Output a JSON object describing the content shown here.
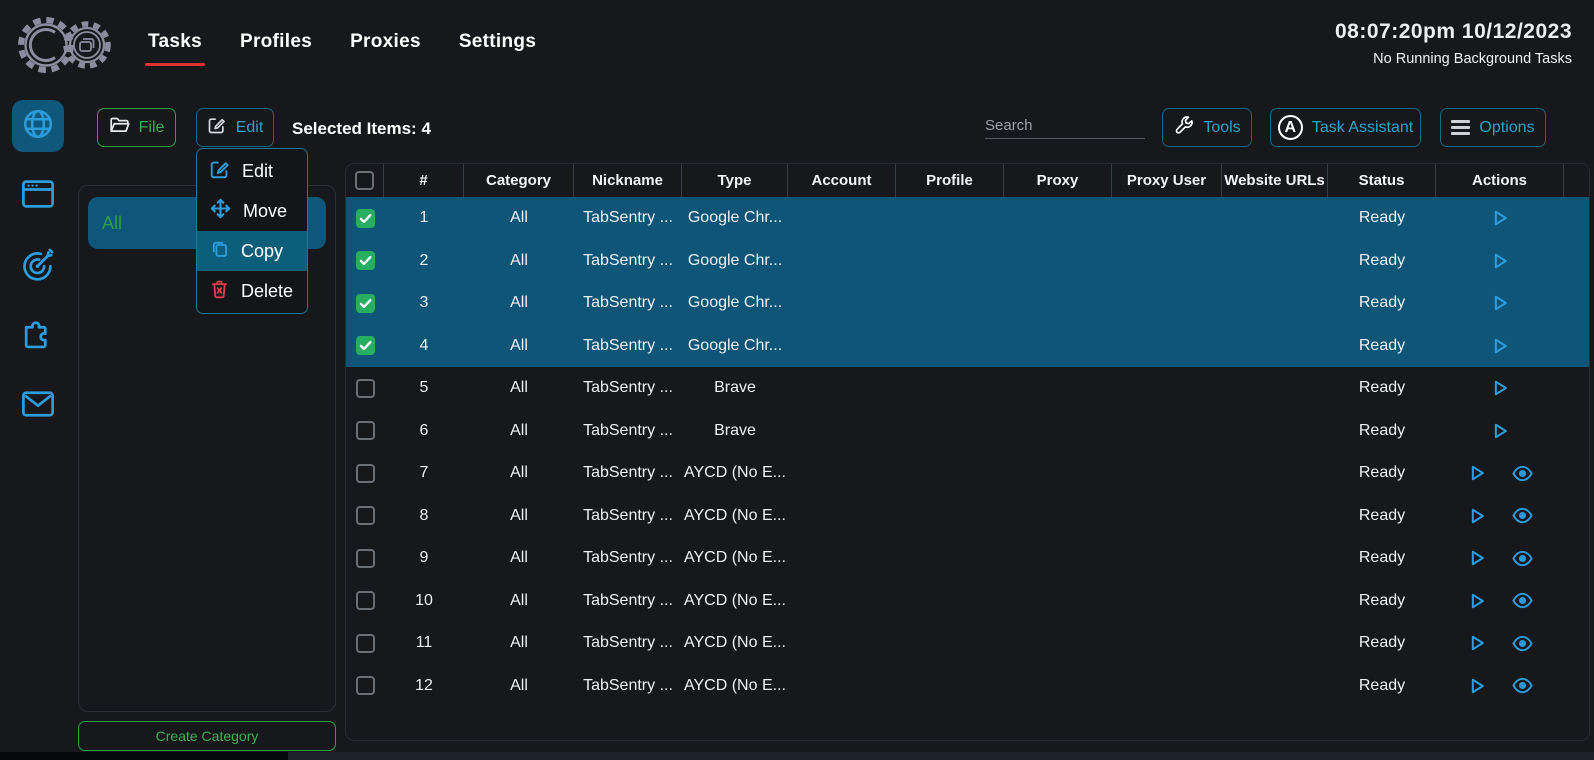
{
  "topbar": {
    "nav": [
      {
        "label": "Tasks",
        "active": true
      },
      {
        "label": "Profiles",
        "active": false
      },
      {
        "label": "Proxies",
        "active": false
      },
      {
        "label": "Settings",
        "active": false
      }
    ],
    "clock": "08:07:20pm 10/12/2023",
    "background_status": "No Running Background Tasks"
  },
  "sidebar": {
    "items": [
      {
        "icon": "globe",
        "active": true
      },
      {
        "icon": "browser-window",
        "active": false
      },
      {
        "icon": "target-dart",
        "active": false
      },
      {
        "icon": "puzzle-piece",
        "active": false
      },
      {
        "icon": "mail-envelope",
        "active": false
      }
    ]
  },
  "toolbar": {
    "file_label": "File",
    "edit_label": "Edit",
    "selected_items": "Selected Items: 4",
    "search_placeholder": "Search",
    "tools_label": "Tools",
    "task_assistant_label": "Task Assistant",
    "options_label": "Options"
  },
  "edit_menu": {
    "items": [
      {
        "label": "Edit",
        "icon": "edit-pencil",
        "highlighted": false,
        "danger": false
      },
      {
        "label": "Move",
        "icon": "move-arrows",
        "highlighted": false,
        "danger": false
      },
      {
        "label": "Copy",
        "icon": "copy-squares",
        "highlighted": true,
        "danger": false
      },
      {
        "label": "Delete",
        "icon": "trash",
        "highlighted": false,
        "danger": true
      }
    ]
  },
  "categories": {
    "selected_category": "All",
    "create_button_label": "Create Category"
  },
  "table": {
    "columns": [
      "",
      "#",
      "Category",
      "Nickname",
      "Type",
      "Account",
      "Profile",
      "Proxy",
      "Proxy User",
      "Website URLs",
      "Status",
      "Actions"
    ],
    "rows": [
      {
        "num": "1",
        "category": "All",
        "nickname": "TabSentry ...",
        "type": "Google Chr...",
        "account": "",
        "profile": "",
        "proxy": "",
        "proxy_user": "",
        "website_urls": "",
        "status": "Ready",
        "checked": true,
        "selected": true,
        "actions": [
          "play"
        ]
      },
      {
        "num": "2",
        "category": "All",
        "nickname": "TabSentry ...",
        "type": "Google Chr...",
        "account": "",
        "profile": "",
        "proxy": "",
        "proxy_user": "",
        "website_urls": "",
        "status": "Ready",
        "checked": true,
        "selected": true,
        "actions": [
          "play"
        ]
      },
      {
        "num": "3",
        "category": "All",
        "nickname": "TabSentry ...",
        "type": "Google Chr...",
        "account": "",
        "profile": "",
        "proxy": "",
        "proxy_user": "",
        "website_urls": "",
        "status": "Ready",
        "checked": true,
        "selected": true,
        "actions": [
          "play"
        ]
      },
      {
        "num": "4",
        "category": "All",
        "nickname": "TabSentry ...",
        "type": "Google Chr...",
        "account": "",
        "profile": "",
        "proxy": "",
        "proxy_user": "",
        "website_urls": "",
        "status": "Ready",
        "checked": true,
        "selected": true,
        "actions": [
          "play"
        ]
      },
      {
        "num": "5",
        "category": "All",
        "nickname": "TabSentry ...",
        "type": "Brave",
        "account": "",
        "profile": "",
        "proxy": "",
        "proxy_user": "",
        "website_urls": "",
        "status": "Ready",
        "checked": false,
        "selected": false,
        "actions": [
          "play"
        ]
      },
      {
        "num": "6",
        "category": "All",
        "nickname": "TabSentry ...",
        "type": "Brave",
        "account": "",
        "profile": "",
        "proxy": "",
        "proxy_user": "",
        "website_urls": "",
        "status": "Ready",
        "checked": false,
        "selected": false,
        "actions": [
          "play"
        ]
      },
      {
        "num": "7",
        "category": "All",
        "nickname": "TabSentry ...",
        "type": "AYCD (No E...",
        "account": "",
        "profile": "",
        "proxy": "",
        "proxy_user": "",
        "website_urls": "",
        "status": "Ready",
        "checked": false,
        "selected": false,
        "actions": [
          "play",
          "eye"
        ]
      },
      {
        "num": "8",
        "category": "All",
        "nickname": "TabSentry ...",
        "type": "AYCD (No E...",
        "account": "",
        "profile": "",
        "proxy": "",
        "proxy_user": "",
        "website_urls": "",
        "status": "Ready",
        "checked": false,
        "selected": false,
        "actions": [
          "play",
          "eye"
        ]
      },
      {
        "num": "9",
        "category": "All",
        "nickname": "TabSentry ...",
        "type": "AYCD (No E...",
        "account": "",
        "profile": "",
        "proxy": "",
        "proxy_user": "",
        "website_urls": "",
        "status": "Ready",
        "checked": false,
        "selected": false,
        "actions": [
          "play",
          "eye"
        ]
      },
      {
        "num": "10",
        "category": "All",
        "nickname": "TabSentry ...",
        "type": "AYCD (No E...",
        "account": "",
        "profile": "",
        "proxy": "",
        "proxy_user": "",
        "website_urls": "",
        "status": "Ready",
        "checked": false,
        "selected": false,
        "actions": [
          "play",
          "eye"
        ]
      },
      {
        "num": "11",
        "category": "All",
        "nickname": "TabSentry ...",
        "type": "AYCD (No E...",
        "account": "",
        "profile": "",
        "proxy": "",
        "proxy_user": "",
        "website_urls": "",
        "status": "Ready",
        "checked": false,
        "selected": false,
        "actions": [
          "play",
          "eye"
        ]
      },
      {
        "num": "12",
        "category": "All",
        "nickname": "TabSentry ...",
        "type": "AYCD (No E...",
        "account": "",
        "profile": "",
        "proxy": "",
        "proxy_user": "",
        "website_urls": "",
        "status": "Ready",
        "checked": false,
        "selected": false,
        "actions": [
          "play",
          "eye"
        ]
      }
    ]
  },
  "colors": {
    "accent_blue": "#2d9cdb",
    "selected_row": "#0e5578",
    "active_tile": "#10577c",
    "green": "#2f9e44",
    "teal_border": "#17657f",
    "teal_label": "#2aa3c7",
    "red_accent": "#e03131",
    "menu_highlight": "#0d5e7b",
    "checkbox_checked": "#27ae60"
  }
}
